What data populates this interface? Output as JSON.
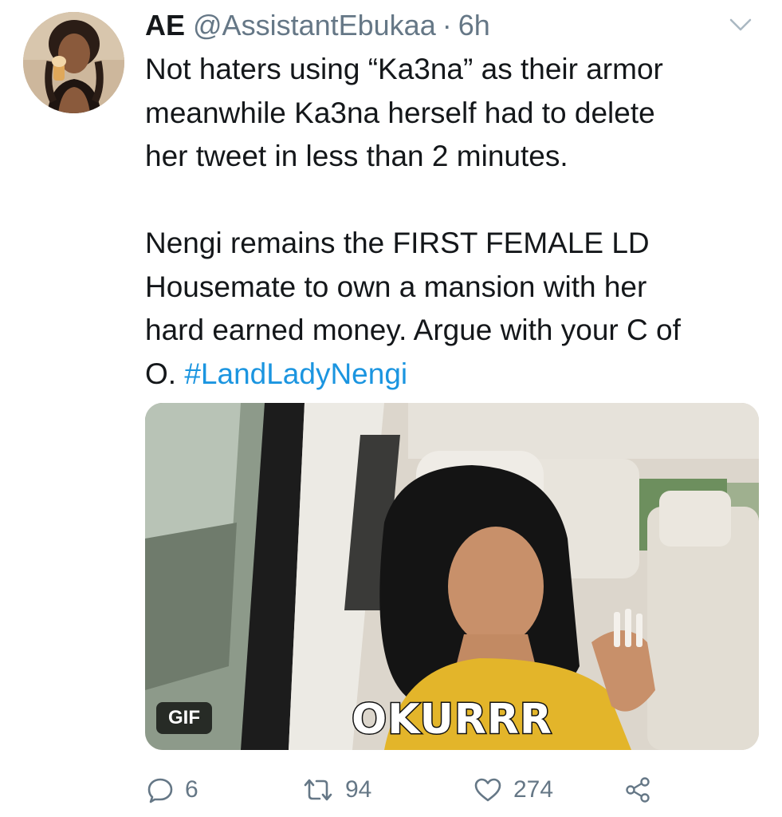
{
  "tweet": {
    "author": {
      "display_name": "AE",
      "handle": "@AssistantEbukaa",
      "separator": "·",
      "time": "6h"
    },
    "paragraph_1": [
      "Not haters using “Ka3na” as their armor",
      "meanwhile Ka3na herself had to delete",
      "her tweet in less than 2 minutes."
    ],
    "paragraph_2": [
      "Nengi remains the FIRST FEMALE LD",
      "Housemate to own a mansion with her",
      "hard earned money.  Argue with your C of"
    ],
    "paragraph_2_last_prefix": "O. ",
    "hashtag": "#LandLadyNengi",
    "media": {
      "badge": "GIF",
      "caption": "OKURRR"
    },
    "actions": {
      "reply_icon": "speech-bubble-icon",
      "reply_count": "6",
      "retweet_icon": "retweet-arrows-icon",
      "retweet_count": "94",
      "like_icon": "heart-icon",
      "like_count": "274",
      "share_icon": "share-nodes-icon"
    },
    "menu_icon": "chevron-down-icon"
  },
  "colors": {
    "text": "#14171a",
    "secondary": "#657786",
    "link": "#1b95e0",
    "background": "#ffffff"
  }
}
